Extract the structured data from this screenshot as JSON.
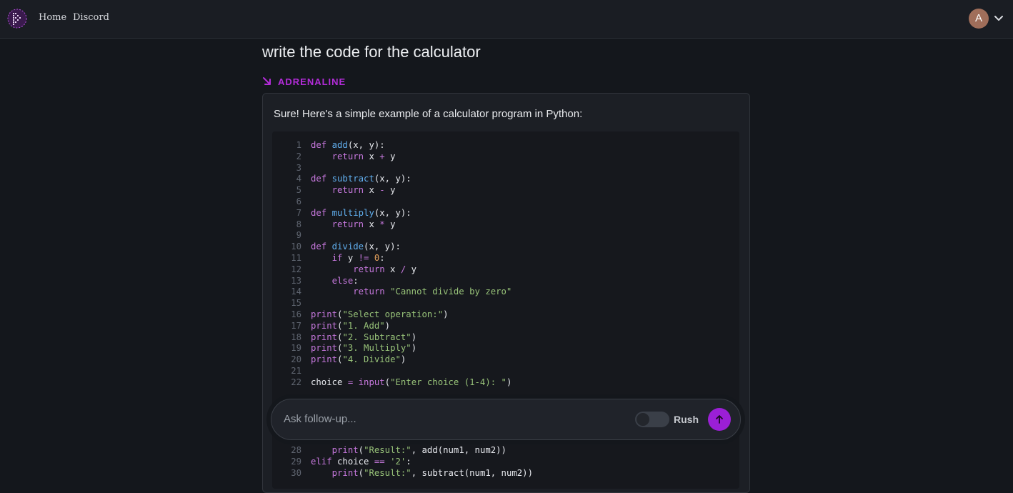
{
  "nav": {
    "logo_name": "app-logo",
    "home": "Home",
    "discord": "Discord",
    "avatar_initial": "A"
  },
  "thread": {
    "question": "write the code for the calculator",
    "brand_label": "ADRENALINE",
    "answer_intro": "Sure! Here's a simple example of a calculator program in Python:"
  },
  "code": {
    "language": "python",
    "lines": [
      {
        "n": "1",
        "text": "def add(x, y):"
      },
      {
        "n": "2",
        "text": "    return x + y"
      },
      {
        "n": "3",
        "text": ""
      },
      {
        "n": "4",
        "text": "def subtract(x, y):"
      },
      {
        "n": "5",
        "text": "    return x - y"
      },
      {
        "n": "6",
        "text": ""
      },
      {
        "n": "7",
        "text": "def multiply(x, y):"
      },
      {
        "n": "8",
        "text": "    return x * y"
      },
      {
        "n": "9",
        "text": ""
      },
      {
        "n": "10",
        "text": "def divide(x, y):"
      },
      {
        "n": "11",
        "text": "    if y != 0:"
      },
      {
        "n": "12",
        "text": "        return x / y"
      },
      {
        "n": "13",
        "text": "    else:"
      },
      {
        "n": "14",
        "text": "        return \"Cannot divide by zero\""
      },
      {
        "n": "15",
        "text": ""
      },
      {
        "n": "16",
        "text": "print(\"Select operation:\")"
      },
      {
        "n": "17",
        "text": "print(\"1. Add\")"
      },
      {
        "n": "18",
        "text": "print(\"2. Subtract\")"
      },
      {
        "n": "19",
        "text": "print(\"3. Multiply\")"
      },
      {
        "n": "20",
        "text": "print(\"4. Divide\")"
      },
      {
        "n": "21",
        "text": ""
      },
      {
        "n": "22",
        "text": "choice = input(\"Enter choice (1-4): \")"
      }
    ],
    "lines_after": [
      {
        "n": "28",
        "text": "    print(\"Result:\", add(num1, num2))"
      },
      {
        "n": "29",
        "text": "elif choice == '2':"
      },
      {
        "n": "30",
        "text": "    print(\"Result:\", subtract(num1, num2))"
      }
    ]
  },
  "followup": {
    "placeholder": "Ask follow-up...",
    "rush_label": "Rush",
    "rush_enabled": false
  },
  "colors": {
    "background": "#14171c",
    "accent": "#9b1fd6",
    "brand": "#b32cd9"
  }
}
